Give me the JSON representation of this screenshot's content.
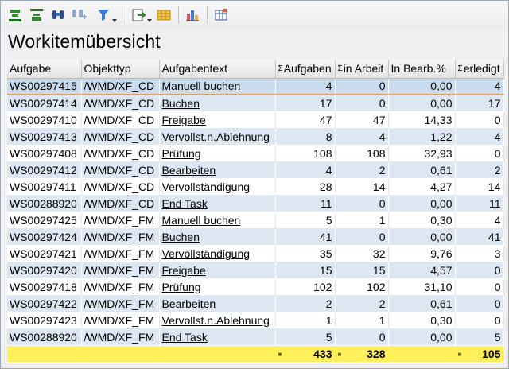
{
  "window": {
    "title": "Workitemübersicht"
  },
  "toolbar": {
    "buttons": [
      {
        "icon": "align-bottom-icon"
      },
      {
        "icon": "align-top-icon"
      },
      {
        "icon": "binoculars-find-icon"
      },
      {
        "icon": "find-next-icon"
      },
      {
        "icon": "filter-icon",
        "dropdown": true
      },
      {
        "icon": "export-icon",
        "dropdown": true
      },
      {
        "icon": "layout-grid-icon"
      },
      {
        "icon": "bar-chart-icon"
      },
      {
        "icon": "column-settings-icon"
      }
    ]
  },
  "table": {
    "headers": [
      "Aufgabe",
      "Objekttyp",
      "Aufgabentext",
      "Aufgaben",
      "in Arbeit",
      "In Bearb.%",
      "erledigt"
    ],
    "sum_columns": [
      3,
      4,
      6
    ],
    "rows": [
      [
        "WS00297415",
        "/WMD/XF_CD",
        "Manuell buchen",
        "4",
        "0",
        "0,00",
        "4"
      ],
      [
        "WS00297414",
        "/WMD/XF_CD",
        "Buchen",
        "17",
        "0",
        "0,00",
        "17"
      ],
      [
        "WS00297410",
        "/WMD/XF_CD",
        "Freigabe",
        "47",
        "47",
        "14,33",
        "0"
      ],
      [
        "WS00297413",
        "/WMD/XF_CD",
        "Vervollst.n.Ablehnung",
        "8",
        "4",
        "1,22",
        "4"
      ],
      [
        "WS00297408",
        "/WMD/XF_CD",
        "Prüfung",
        "108",
        "108",
        "32,93",
        "0"
      ],
      [
        "WS00297412",
        "/WMD/XF_CD",
        "Bearbeiten",
        "4",
        "2",
        "0,61",
        "2"
      ],
      [
        "WS00297411",
        "/WMD/XF_CD",
        "Vervollständigung",
        "28",
        "14",
        "4,27",
        "14"
      ],
      [
        "WS00288920",
        "/WMD/XF_CD",
        "End Task",
        "11",
        "0",
        "0,00",
        "11"
      ],
      [
        "WS00297425",
        "/WMD/XF_FM",
        "Manuell buchen",
        "5",
        "1",
        "0,30",
        "4"
      ],
      [
        "WS00297424",
        "/WMD/XF_FM",
        "Buchen",
        "41",
        "0",
        "0,00",
        "41"
      ],
      [
        "WS00297421",
        "/WMD/XF_FM",
        "Vervollständigung",
        "35",
        "32",
        "9,76",
        "3"
      ],
      [
        "WS00297420",
        "/WMD/XF_FM",
        "Freigabe",
        "15",
        "15",
        "4,57",
        "0"
      ],
      [
        "WS00297418",
        "/WMD/XF_FM",
        "Prüfung",
        "102",
        "102",
        "31,10",
        "0"
      ],
      [
        "WS00297422",
        "/WMD/XF_FM",
        "Bearbeiten",
        "2",
        "2",
        "0,61",
        "0"
      ],
      [
        "WS00297423",
        "/WMD/XF_FM",
        "Vervollst.n.Ablehnung",
        "1",
        "1",
        "0,30",
        "0"
      ],
      [
        "WS00288920",
        "/WMD/XF_FM",
        "End Task",
        "5",
        "0",
        "0,00",
        "5"
      ]
    ],
    "totals": {
      "aufgaben": "433",
      "in_arbeit": "328",
      "erledigt": "105"
    },
    "selected_row": 0
  },
  "colors": {
    "row_alt": "#dde7f3",
    "row_selected": "#c9dcee",
    "total_row": "#ffef5a",
    "selection_underline": "#e8a04a"
  }
}
